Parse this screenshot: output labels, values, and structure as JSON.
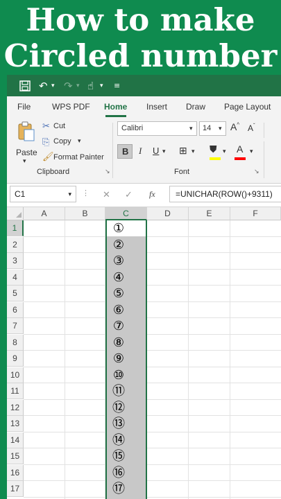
{
  "headline": {
    "line1": "How to make",
    "line2": "Circled number"
  },
  "quick_access": {
    "save_icon": "save-icon",
    "undo_icon": "undo-icon",
    "redo_icon": "redo-icon",
    "touch_icon": "touch-mode-icon",
    "customize_icon": "customize-qat-icon"
  },
  "tabs": [
    {
      "label": "File"
    },
    {
      "label": "WPS PDF"
    },
    {
      "label": "Home"
    },
    {
      "label": "Insert"
    },
    {
      "label": "Draw"
    },
    {
      "label": "Page Layout"
    }
  ],
  "clipboard": {
    "paste": "Paste",
    "cut": "Cut",
    "copy": "Copy",
    "format_painter": "Format Painter",
    "group_label": "Clipboard"
  },
  "font": {
    "name": "Calibri",
    "size": "14",
    "bold": "B",
    "italic": "I",
    "underline": "U",
    "group_label": "Font",
    "grow": "A",
    "shrink": "A",
    "fill_color": "#ffff00",
    "font_color_bar": "#ff0000",
    "font_color_letter": "A"
  },
  "formula_bar": {
    "name_box": "C1",
    "cancel": "✕",
    "enter": "✓",
    "fx": "fx",
    "formula": "=UNICHAR(ROW()+9311)"
  },
  "grid": {
    "columns": [
      "A",
      "B",
      "C",
      "D",
      "E",
      "F"
    ],
    "selected_column": "C",
    "rows": [
      "1",
      "2",
      "3",
      "4",
      "5",
      "6",
      "7",
      "8",
      "9",
      "10",
      "11",
      "12",
      "13",
      "14",
      "15",
      "16",
      "17"
    ],
    "column_c_values": [
      "①",
      "②",
      "③",
      "④",
      "⑤",
      "⑥",
      "⑦",
      "⑧",
      "⑨",
      "⑩",
      "⑪",
      "⑫",
      "⑬",
      "⑭",
      "⑮",
      "⑯",
      "⑰"
    ]
  },
  "colors": {
    "brand_green": "#217346",
    "page_bg": "#0f8b4f"
  }
}
